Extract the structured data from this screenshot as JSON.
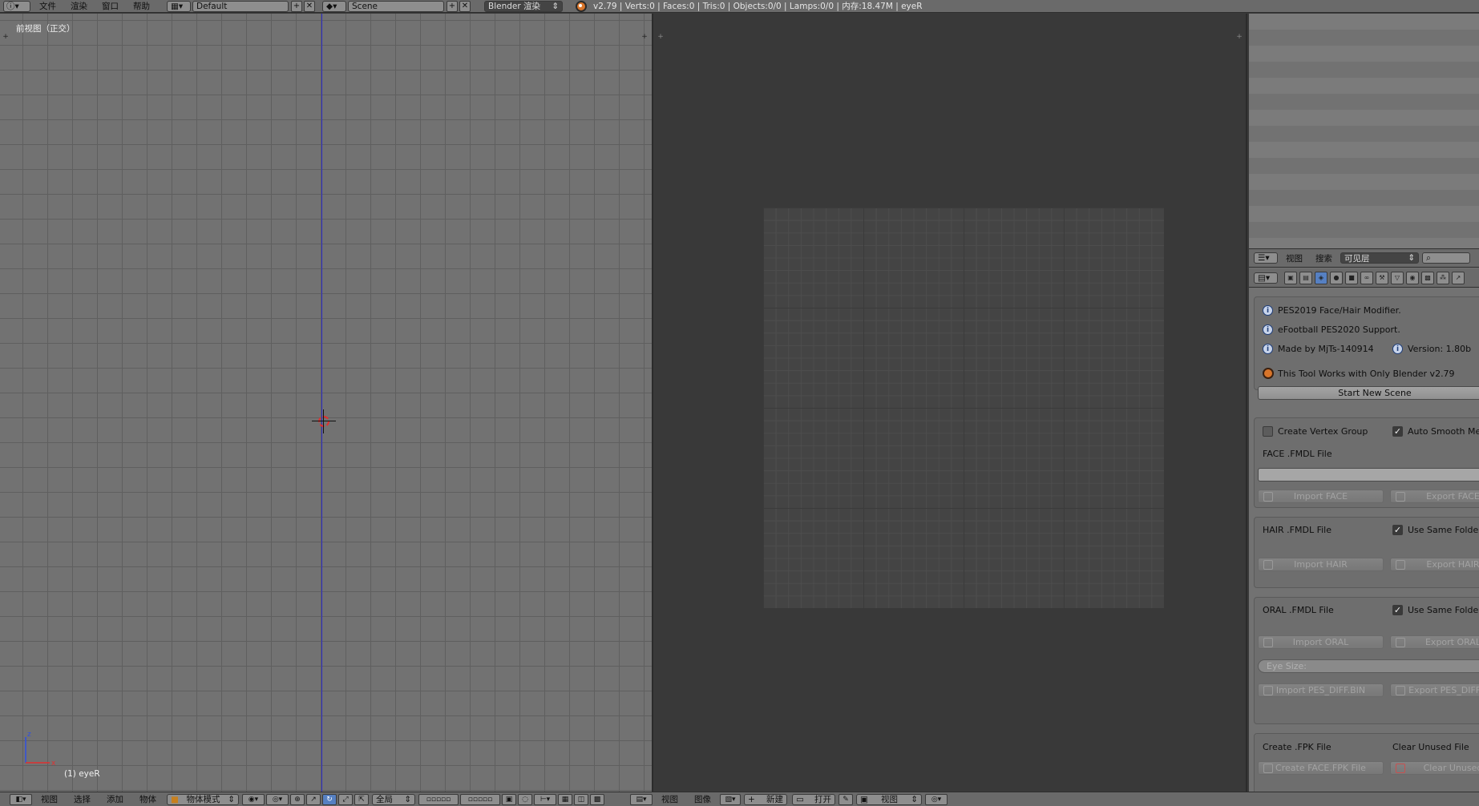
{
  "topbar": {
    "info_icon": "info-icon",
    "menu": [
      "文件",
      "渲染",
      "窗口",
      "帮助"
    ],
    "screen_layout": "Default",
    "scene": "Scene",
    "render_engine": "Blender 渲染",
    "stats": "v2.79 | Verts:0 | Faces:0 | Tris:0 | Objects:0/0 | Lamps:0/0 | 内存:18.47M | eyeR"
  },
  "viewport3d": {
    "view_label": "前视图（正交）",
    "object_label": "(1) eyeR",
    "axis_z": "z",
    "axis_x": "x",
    "header_menu": [
      "视图",
      "选择",
      "添加",
      "物体"
    ],
    "mode": "物体模式",
    "pivot_global": "全局"
  },
  "uv_editor": {
    "header_menu": [
      "视图",
      "图像"
    ],
    "new_label": "新建",
    "open_label": "打开",
    "view_dropdown": "视图"
  },
  "outliner": {
    "menu": [
      "视图",
      "搜索"
    ],
    "display_mode": "可见层"
  },
  "properties": {
    "panel1": {
      "line1": "PES2019 Face/Hair Modifier.",
      "line2": "eFootball PES2020 Support.",
      "line3_left": "Made by MjTs-140914",
      "line3_right": "Version: 1.80b",
      "line4": "This Tool Works with Only Blender v2.79",
      "start_button": "Start New Scene"
    },
    "panel2": {
      "create_vertex_group": "Create Vertex Group",
      "create_vertex_group_checked": false,
      "auto_smooth": "Auto Smooth Mesh",
      "auto_smooth_checked": true,
      "face_label": "FACE .FMDL File",
      "face_path": "",
      "import_face": "Import FACE",
      "export_face": "Export FACE"
    },
    "panel3": {
      "hair_label": "HAIR .FMDL File",
      "use_same_folder": "Use Same Folder",
      "use_same_folder_checked": true,
      "import_hair": "Import HAIR",
      "export_hair": "Export HAIR"
    },
    "panel4": {
      "oral_label": "ORAL .FMDL File",
      "use_same_folder": "Use Same Folder",
      "use_same_folder_checked": true,
      "import_oral": "Import ORAL",
      "export_oral": "Export ORAL",
      "eye_size": "Eye Size:",
      "import_pes_diff": "Import PES_DIFF.BIN",
      "export_pes_diff": "Export PES_DIFF.BIN"
    },
    "panel5": {
      "create_fpk": "Create .FPK File",
      "clear_unused": "Clear Unused File",
      "create_face_fpk": "Create FACE.FPK File",
      "clear_unused_btn": "Clear Unused"
    }
  }
}
